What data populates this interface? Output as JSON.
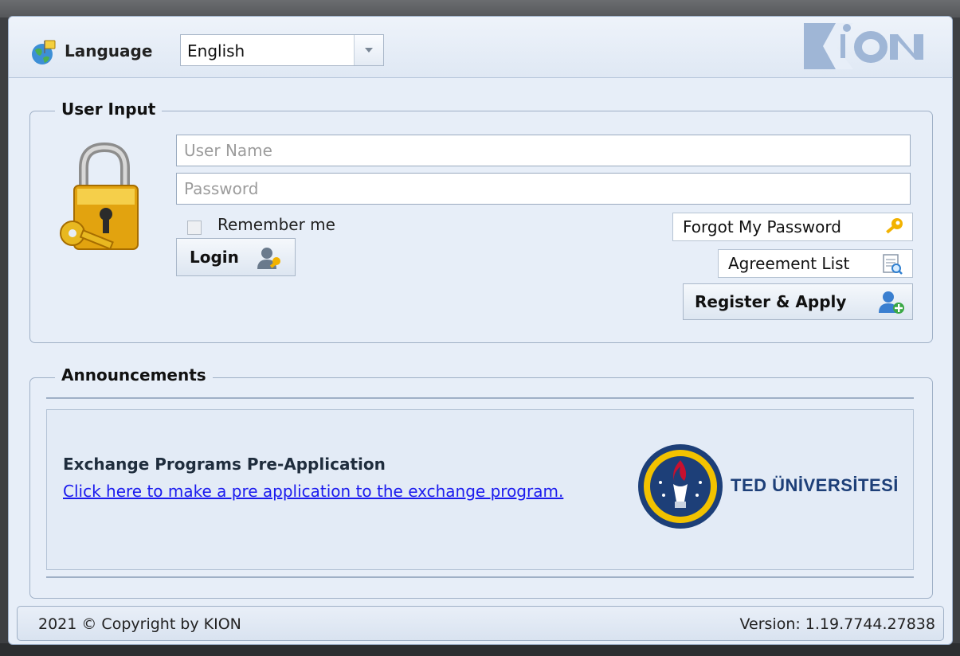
{
  "header": {
    "language_label": "Language",
    "language_selected": "English",
    "logo_text": "KION",
    "icons": {
      "globe": "globe-flag-icon",
      "dropdown": "chevron-down-icon"
    }
  },
  "user_input": {
    "legend": "User Input",
    "username_placeholder": "User Name",
    "username_value": "",
    "password_placeholder": "Password",
    "password_value": "",
    "remember_label": "Remember me",
    "remember_checked": false,
    "login_label": "Login",
    "forgot_label": "Forgot My Password",
    "agreement_label": "Agreement List",
    "register_label": "Register & Apply"
  },
  "announcements": {
    "legend": "Announcements",
    "title": "Exchange Programs Pre-Application",
    "link_text": "Click here to make a pre application to the exchange program.",
    "university_name": "TED ÜNİVERSİTESİ"
  },
  "footer": {
    "copyright": "2021 © Copyright by KION",
    "version": "Version: 1.19.7744.27838"
  },
  "colors": {
    "window_bg": "#e7eef8",
    "border": "#9fb0c6",
    "link": "#1a1aee",
    "ted_blue": "#1d3f78",
    "ted_red": "#c8102e",
    "accent_gold": "#f2b200"
  }
}
